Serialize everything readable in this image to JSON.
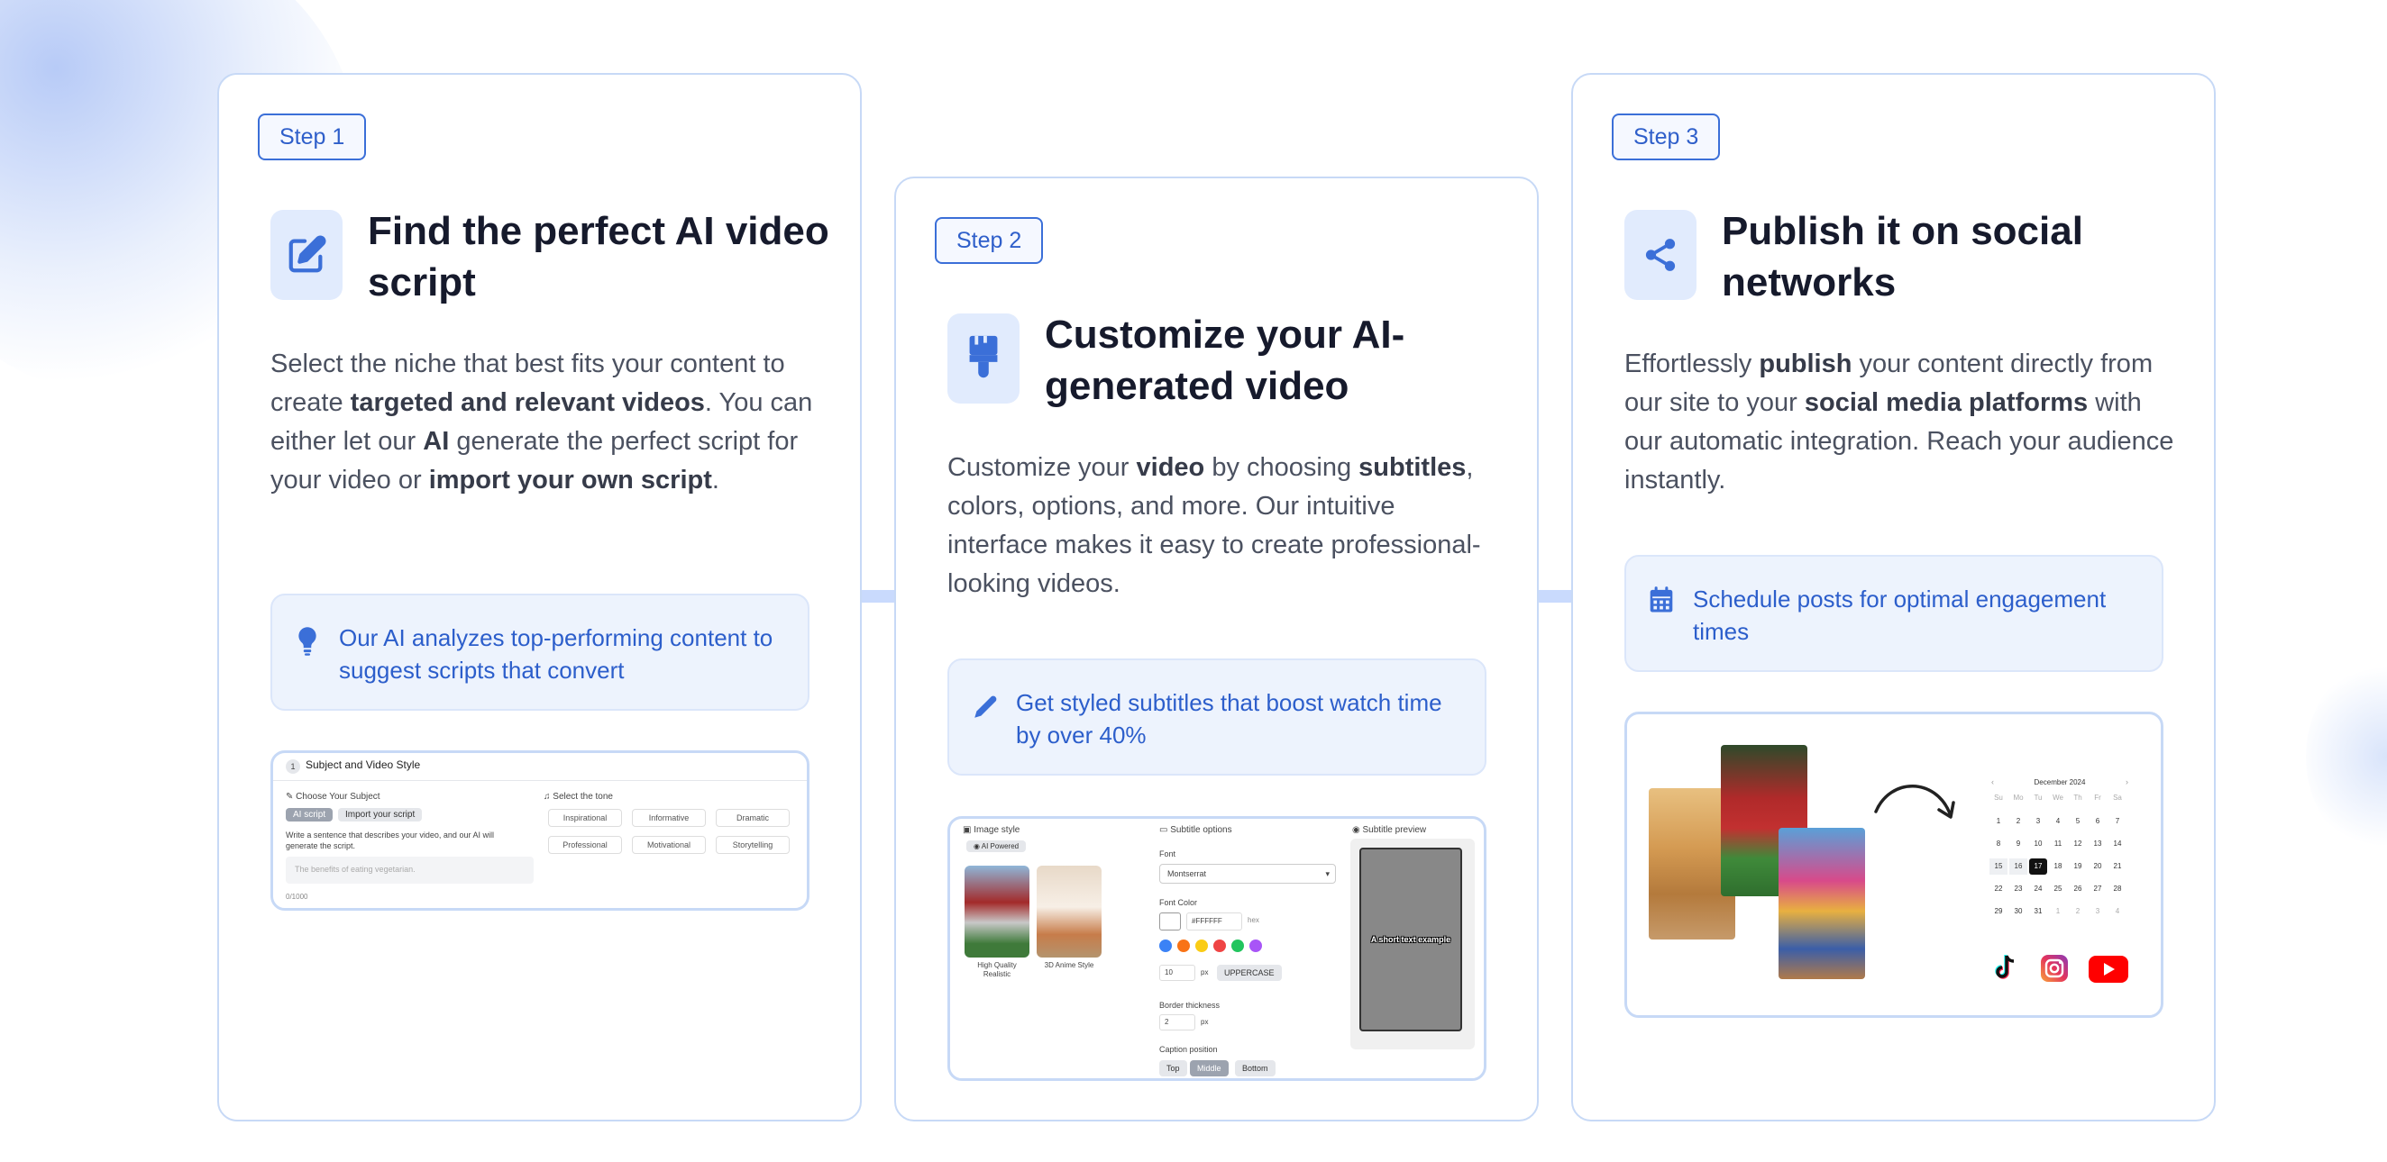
{
  "steps": [
    {
      "badge": "Step 1",
      "icon": "edit-icon",
      "title": "Find the perfect AI video script",
      "desc": {
        "t1": "Select the niche that best fits your content to create ",
        "b1": "targeted and relevant videos",
        "t2": ". You can either let our ",
        "b2": "AI",
        "t3": " generate the perfect script for your video or ",
        "b3": "import your own script",
        "t4": "."
      },
      "tip": {
        "icon": "lightbulb-icon",
        "text": "Our AI analyzes top-performing content to suggest scripts that convert"
      },
      "preview": {
        "num": "1",
        "header": "Subject and Video Style",
        "choose_subject": "Choose Your Subject",
        "ai_script": "AI script",
        "import_script": "Import your script",
        "hint": "Write a sentence that describes your video, and our AI will generate the script.",
        "placeholder": "The benefits of eating vegetarian.",
        "counter": "0/1000",
        "select_tone": "Select the tone",
        "tones": [
          "Inspirational",
          "Informative",
          "Dramatic",
          "Professional",
          "Motivational",
          "Storytelling"
        ]
      }
    },
    {
      "badge": "Step 2",
      "icon": "paintbrush-icon",
      "title": "Customize your AI-generated video",
      "desc": {
        "t1": "Customize your ",
        "b1": "video",
        "t2": " by choosing ",
        "b2": "subtitles",
        "t3": ", colors, options, and more. Our intuitive interface makes it easy to create professional-looking videos."
      },
      "tip": {
        "icon": "pencil-icon",
        "text": "Get styled subtitles that boost watch time by over 40%"
      },
      "preview": {
        "image_style": "Image style",
        "ai_powered": "AI Powered",
        "style1": "High Quality Realistic",
        "style2": "3D Anime Style",
        "subtitle_options": "Subtitle options",
        "font_label": "Font",
        "font_value": "Montserrat",
        "font_color_label": "Font Color",
        "hex_value": "#FFFFFF",
        "hex_label": "hex",
        "size_value": "10",
        "px": "px",
        "uppercase": "UPPERCASE",
        "border_label": "Border thickness",
        "border_value": "2",
        "caption_label": "Caption position",
        "positions": [
          "Top",
          "Middle",
          "Bottom"
        ],
        "preview_label": "Subtitle preview",
        "preview_text": "A short text example",
        "swatch_colors": [
          "#3b82f6",
          "#f97316",
          "#facc15",
          "#ef4444",
          "#22c55e",
          "#a855f7"
        ]
      }
    },
    {
      "badge": "Step 3",
      "icon": "share-icon",
      "title": "Publish it on social networks",
      "desc": {
        "t1": "Effortlessly ",
        "b1": "publish",
        "t2": " your content directly from our site to your ",
        "b2": "social media platforms",
        "t3": " with our automatic integration. Reach your audience instantly."
      },
      "tip": {
        "icon": "calendar-icon",
        "text": "Schedule posts for optimal engagement times"
      },
      "preview": {
        "month": "December 2024",
        "weekdays": [
          "Su",
          "Mo",
          "Tu",
          "We",
          "Th",
          "Fr",
          "Sa"
        ],
        "weeks": [
          [
            "1",
            "2",
            "3",
            "4",
            "5",
            "6",
            "7"
          ],
          [
            "8",
            "9",
            "10",
            "11",
            "12",
            "13",
            "14"
          ],
          [
            "15",
            "16",
            "17",
            "18",
            "19",
            "20",
            "21"
          ],
          [
            "22",
            "23",
            "24",
            "25",
            "26",
            "27",
            "28"
          ],
          [
            "29",
            "30",
            "31",
            "1",
            "2",
            "3",
            "4"
          ]
        ],
        "selected_day": "17",
        "socials": [
          "tiktok-icon",
          "instagram-icon",
          "youtube-icon"
        ]
      }
    }
  ]
}
